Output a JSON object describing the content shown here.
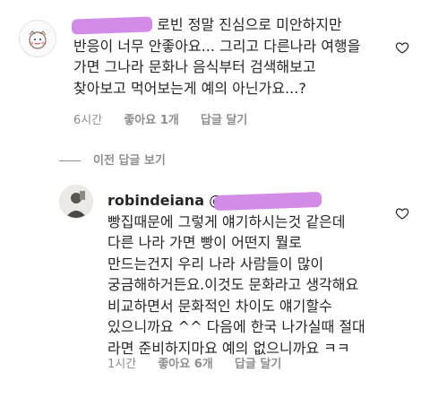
{
  "first_comment": {
    "line1_suffix": "로빈 정말 진심으로 미안하지만",
    "lines_rest": [
      "반응이 너무 안좋아요... 그리고 다른나라 여행을",
      "가면 그나라 문화나 음식부터 검색해보고",
      "찾아보고 먹어보는게 예의 아닌가요...?"
    ],
    "time": "6시간",
    "likes": "좋아요 1개",
    "reply": "답글 달기",
    "like_icon": "heart-outline-icon"
  },
  "view_previous": "이전 답글 보기",
  "reply_comment": {
    "username": "robindeiana",
    "mention_prefix": "@",
    "lines": [
      "빵집때문에 그렇게 얘기하시는것 같은데",
      "다른 나라 가면 빵이 어떤지 뭘로",
      "만드는건지 우리 나라 사람들이 많이",
      "궁금해하거든요.이것도 문화라고 생각해요",
      "비교하면서 문화적인 차이도 얘기할수",
      "있으니까요 ^^ 다음에 한국 나가실때 절대",
      "라면 준비하지마요 예의 없으니까요 ㅋㅋ"
    ],
    "time": "1시간",
    "likes": "좋아요 6개",
    "reply": "답글 달기",
    "like_icon": "heart-outline-icon"
  },
  "colors": {
    "text": "#262626",
    "meta": "#8e8e8e",
    "redaction": "#d28be6"
  }
}
